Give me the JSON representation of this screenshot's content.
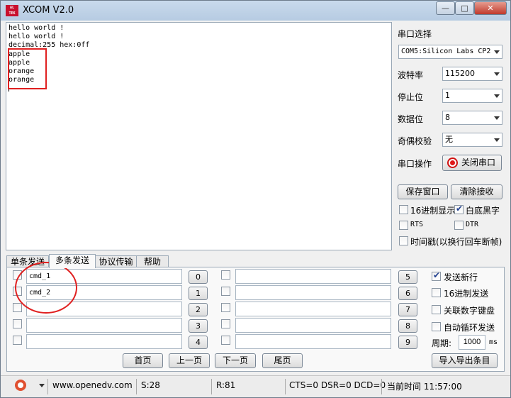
{
  "window": {
    "title": "XCOM V2.0",
    "app_icon_text": "ALIENTEK"
  },
  "title_buttons": {
    "minimize": "—",
    "maximize": "□",
    "close": "✕"
  },
  "receive": {
    "lines": [
      "hello world !",
      "hello world !",
      "decimal:255 hex:0ff",
      "apple",
      "apple",
      "orange",
      "orange"
    ]
  },
  "side": {
    "port_select_label": "串口选择",
    "port_value": "COM5:Silicon Labs CP2",
    "baud_label": "波特率",
    "baud_value": "115200",
    "stopbits_label": "停止位",
    "stopbits_value": "1",
    "databits_label": "数据位",
    "databits_value": "8",
    "parity_label": "奇偶校验",
    "parity_value": "无",
    "port_op_label": "串口操作",
    "close_port_button": "关闭串口",
    "save_window_button": "保存窗口",
    "clear_receive_button": "清除接收",
    "hex_display": {
      "label": "16进制显示",
      "checked": false
    },
    "white_bg": {
      "label": "白底黑字",
      "checked": true
    },
    "rts": {
      "label": "RTS",
      "checked": false
    },
    "dtr": {
      "label": "DTR",
      "checked": false
    },
    "timestamp": {
      "label": "时间戳(以换行回车断帧)",
      "checked": false
    }
  },
  "tabs": [
    {
      "label": "单条发送",
      "active": false
    },
    {
      "label": "多条发送",
      "active": true
    },
    {
      "label": "协议传输",
      "active": false
    },
    {
      "label": "帮助",
      "active": false
    }
  ],
  "multi_send": {
    "left_rows": [
      {
        "value": "cmd_1",
        "button": "0"
      },
      {
        "value": "cmd_2",
        "button": "1"
      },
      {
        "value": "",
        "button": "2"
      },
      {
        "value": "",
        "button": "3"
      },
      {
        "value": "",
        "button": "4"
      }
    ],
    "right_rows": [
      {
        "value": "",
        "button": "5"
      },
      {
        "value": "",
        "button": "6"
      },
      {
        "value": "",
        "button": "7"
      },
      {
        "value": "",
        "button": "8"
      },
      {
        "value": "",
        "button": "9"
      }
    ],
    "options": {
      "send_newline": {
        "label": "发送新行",
        "checked": true
      },
      "hex_send": {
        "label": "16进制发送",
        "checked": false
      },
      "link_keypad": {
        "label": "关联数字键盘",
        "checked": false
      },
      "auto_loop": {
        "label": "自动循环发送",
        "checked": false
      }
    },
    "period_label": "周期:",
    "period_value": "1000",
    "period_unit": "ms",
    "pager": {
      "first": "首页",
      "prev": "上一页",
      "next": "下一页",
      "last": "尾页"
    },
    "import_export_button": "导入导出条目"
  },
  "status": {
    "url": "www.openedv.com",
    "sent": "S:28",
    "received": "R:81",
    "signals": "CTS=0 DSR=0 DCD=0",
    "time": "当前时间 11:57:00"
  },
  "colors": {
    "annotation": "#e02020",
    "titlebar": "#c9daec",
    "close_button": "#c0392b"
  }
}
